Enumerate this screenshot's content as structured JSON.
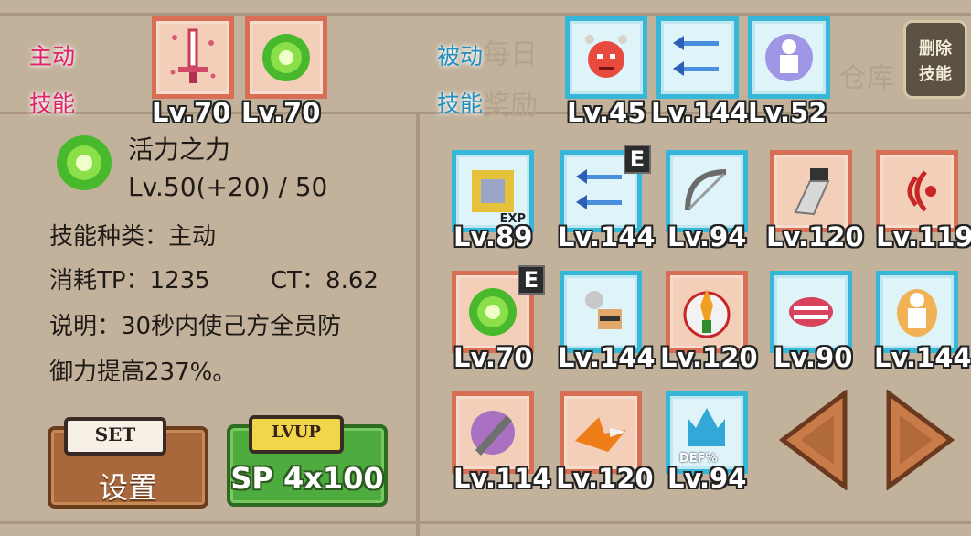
{
  "colors": {
    "active": "#e0236b",
    "passive": "#1f8fc0",
    "red_frame": "#d86e54",
    "blue_frame": "#37b7d8"
  },
  "background_text": {
    "a": "每日",
    "b": "奖励",
    "c": "仓库"
  },
  "active_skills": {
    "label_line1": "主动",
    "label_line2": "技能",
    "slots": [
      {
        "icon": "sword-icon",
        "level": "Lv.70"
      },
      {
        "icon": "green-orb-icon",
        "level": "Lv.70"
      }
    ]
  },
  "passive_skills": {
    "label_line1": "被动",
    "label_line2": "技能",
    "slots": [
      {
        "icon": "angry-face-icon",
        "level": "Lv.45"
      },
      {
        "icon": "triple-arrow-icon",
        "level": "Lv.144"
      },
      {
        "icon": "ghost-figure-icon",
        "level": "Lv.52"
      }
    ]
  },
  "delete_skill": {
    "line1": "删除",
    "line2": "技能"
  },
  "detail": {
    "icon": "green-orb-icon",
    "name": "活力之力",
    "level": "Lv.50(+20) / 50",
    "type": "技能种类：主动",
    "cost": "消耗TP：1235",
    "ct": "CT：8.62",
    "desc_line1": "说明：30秒内使己方全员防",
    "desc_line2": "御力提高237%。"
  },
  "set_button": {
    "cap": "SET",
    "label": "设置"
  },
  "lvup_button": {
    "cap": "LVUP",
    "label": "SP 4x100"
  },
  "inventory": [
    {
      "icon": "exp-chip-icon",
      "level": "Lv.89",
      "frame": "blue",
      "equipped": ""
    },
    {
      "icon": "triple-arrow-icon",
      "level": "Lv.144",
      "frame": "blue",
      "equipped": "E"
    },
    {
      "icon": "bow-icon",
      "level": "Lv.94",
      "frame": "blue",
      "equipped": ""
    },
    {
      "icon": "gauntlet-icon",
      "level": "Lv.120",
      "frame": "red",
      "equipped": ""
    },
    {
      "icon": "sound-wave-icon",
      "level": "Lv.119",
      "frame": "red",
      "equipped": ""
    },
    {
      "icon": "green-orb-icon",
      "level": "Lv.70",
      "frame": "red",
      "equipped": "E"
    },
    {
      "icon": "bandit-icon",
      "level": "Lv.144",
      "frame": "blue",
      "equipped": ""
    },
    {
      "icon": "flame-warrior-icon",
      "level": "Lv.120",
      "frame": "red",
      "equipped": ""
    },
    {
      "icon": "mouth-icon",
      "level": "Lv.90",
      "frame": "blue",
      "equipped": ""
    },
    {
      "icon": "aura-figure-icon",
      "level": "Lv.144",
      "frame": "blue",
      "equipped": ""
    },
    {
      "icon": "purple-blade-icon",
      "level": "Lv.114",
      "frame": "red",
      "equipped": ""
    },
    {
      "icon": "fire-arrow-icon",
      "level": "Lv.120",
      "frame": "red",
      "equipped": ""
    },
    {
      "icon": "def-flame-icon",
      "level": "Lv.94",
      "frame": "blue",
      "equipped": ""
    }
  ],
  "def_tag": "DEF%",
  "exp_tag": "EXP"
}
